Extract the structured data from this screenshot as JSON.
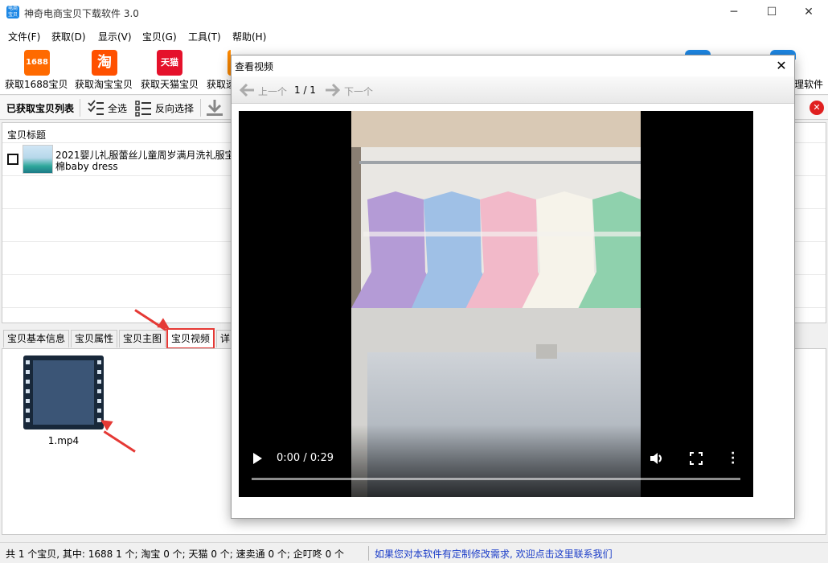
{
  "window": {
    "title": "神奇电商宝贝下载软件 3.0",
    "icon_text": "电商宝贝",
    "controls": [
      "─",
      "☐",
      "✕"
    ]
  },
  "menu": [
    "文件(F)",
    "获取(D)",
    "显示(V)",
    "宝贝(G)",
    "工具(T)",
    "帮助(H)"
  ],
  "toolbar": {
    "buttons": [
      {
        "label": "获取1688宝贝",
        "icon_text": "1688",
        "color": "#ff6a00"
      },
      {
        "label": "获取淘宝宝贝",
        "icon_text": "淘",
        "color": "#ff5000"
      },
      {
        "label": "获取天猫宝贝",
        "icon_text": "天猫",
        "color": "#e5112b"
      },
      {
        "label": "获取速",
        "icon_text": "",
        "color": "#ff8a00"
      }
    ],
    "right_label": "理软件"
  },
  "listbar": {
    "title": "已获取宝贝列表",
    "select_all": "全选",
    "invert": "反向选择"
  },
  "list": {
    "header": "宝贝标题",
    "rows": [
      {
        "title_line1": "2021婴儿礼服蕾丝儿童周岁满月洗礼服宝",
        "title_line2": "棉baby dress"
      }
    ]
  },
  "tabs": [
    "宝贝基本信息",
    "宝贝属性",
    "宝贝主图",
    "宝贝视频",
    "详"
  ],
  "video_file": {
    "name": "1.mp4"
  },
  "dialog": {
    "title": "查看视频",
    "close": "✕",
    "prev": "上一个",
    "page": "1 / 1",
    "next": "下一个",
    "player": {
      "time": "0:00 / 0:29",
      "progress": 0
    }
  },
  "status": {
    "summary": "共 1 个宝贝, 其中: 1688 1 个; 淘宝 0 个; 天猫 0 个; 速卖通 0 个; 企叮咚 0 个",
    "link": "如果您对本软件有定制修改需求, 欢迎点击这里联系我们"
  },
  "colors": {
    "accent_red": "#e53935",
    "link_blue": "#1a3cc8",
    "close_red": "#e02020"
  }
}
